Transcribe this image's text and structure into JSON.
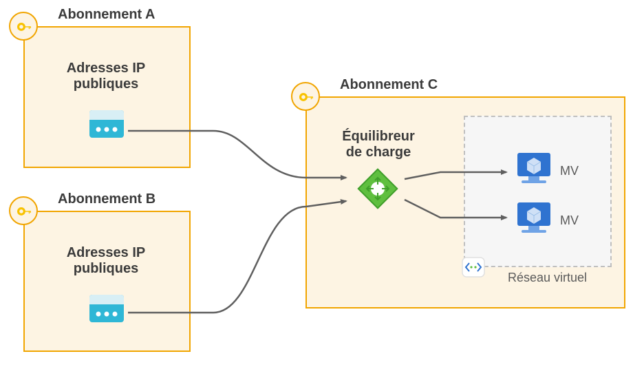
{
  "subscriptionA": {
    "title": "Abonnement A",
    "contentLabel": "Adresses IP\npubliques"
  },
  "subscriptionB": {
    "title": "Abonnement B",
    "contentLabel": "Adresses IP\npubliques"
  },
  "subscriptionC": {
    "title": "Abonnement C",
    "lbLabel": "Équilibreur\nde charge",
    "vm1Label": "MV",
    "vm2Label": "MV",
    "vnetLabel": "Réseau virtuel"
  },
  "colors": {
    "boxFill": "#fdf4e3",
    "boxBorder": "#f1a500",
    "keyYellow": "#f8c200",
    "keyHighlight": "#fff3b0",
    "ipBlue": "#2fb7d6",
    "ipTop": "#d8eff5",
    "lbGreen": "#5fbf3f",
    "lbDark": "#3f9e2a",
    "vmBlue": "#2f73d0",
    "vmLight": "#cfe0f6",
    "vnetBlue": "#2f73d0",
    "arrow": "#5f5f5f"
  }
}
